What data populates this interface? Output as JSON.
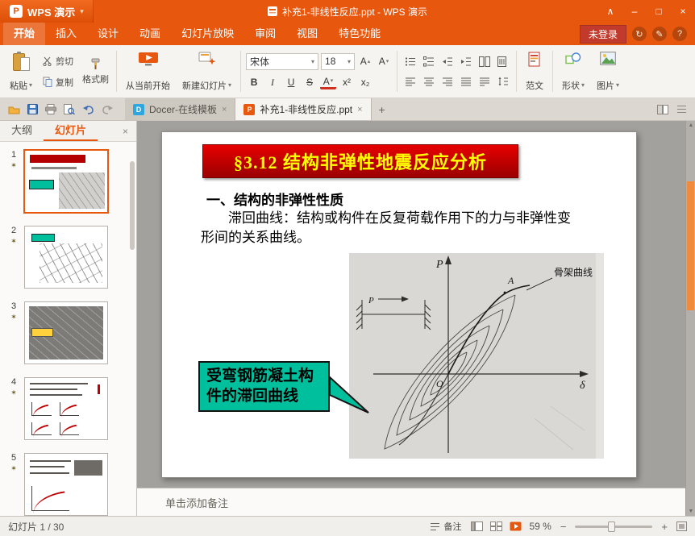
{
  "colors": {
    "accent": "#e8570e",
    "banner_red": "#c00000",
    "callout_teal": "#00bf9c"
  },
  "window": {
    "logo_badge": "P",
    "logo_text": "WPS 演示",
    "doc_title": "补充1-非线性反应.ppt - WPS 演示"
  },
  "icons": {
    "caret_down": "▾",
    "caret_up": "▴",
    "minimize": "–",
    "maximize": "□",
    "close": "×",
    "collapse": "∧",
    "sync": "↻",
    "edit": "✎",
    "help": "?",
    "new_tab": "+",
    "tab_close": "×",
    "panel_close": "×",
    "star": "✶",
    "minus": "−",
    "plus": "+",
    "arrow_up": "▲",
    "arrow_down": "▼"
  },
  "menu": {
    "tabs": [
      "开始",
      "插入",
      "设计",
      "动画",
      "幻灯片放映",
      "审阅",
      "视图",
      "特色功能"
    ],
    "login_button": "未登录"
  },
  "ribbon": {
    "paste": "粘贴",
    "cut": "剪切",
    "copy": "复制",
    "format_painter": "格式刷",
    "play_current": "从当前开始",
    "new_slide": "新建幻灯片",
    "font_name": "宋体",
    "font_size": "18",
    "font_bigger": "A",
    "font_smaller": "A",
    "bold": "B",
    "italic": "I",
    "underline": "U",
    "strikethrough": "S",
    "font_color": "A",
    "superscript": "x²",
    "subscript": "x₂",
    "fanwen": "范文",
    "shapes": "形状",
    "picture": "图片"
  },
  "tabs_bar": {
    "docs": [
      {
        "label": "Docer-在线模板",
        "badge": "D"
      },
      {
        "label": "补充1-非线性反应.ppt",
        "badge": "P"
      }
    ]
  },
  "sidebar": {
    "outline_tab": "大纲",
    "slides_tab": "幻灯片",
    "slides": [
      {
        "num": "1"
      },
      {
        "num": "2"
      },
      {
        "num": "3"
      },
      {
        "num": "4"
      },
      {
        "num": "5"
      }
    ]
  },
  "slide": {
    "title": "§3.12 结构非弹性地震反应分析",
    "heading": "一、结构的非弹性性质",
    "body": "滞回曲线：结构或构件在反复荷载作用下的力与非弹性变形间的关系曲线。",
    "callout": "受弯钢筋凝土构件的滞回曲线",
    "diagram": {
      "axis_p": "P",
      "axis_delta": "δ",
      "origin": "O",
      "point_a": "A",
      "skeleton_label": "骨架曲线",
      "load_p": "P"
    }
  },
  "notes": {
    "placeholder": "单击添加备注"
  },
  "status": {
    "slide_counter": "幻灯片 1 / 30",
    "notes_label": "备注",
    "zoom_value": "59 %"
  }
}
